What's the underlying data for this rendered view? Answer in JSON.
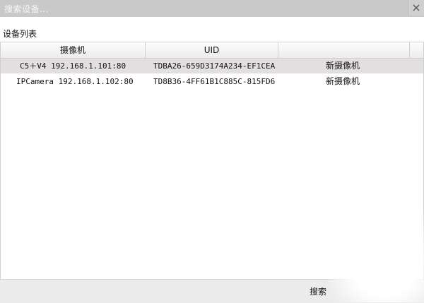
{
  "window": {
    "title": "搜索设备...",
    "close_icon": "close-icon"
  },
  "section": {
    "label": "设备列表"
  },
  "table": {
    "columns": [
      "摄像机",
      "UID",
      ""
    ],
    "rows": [
      {
        "camera": "C5＋V4 192.168.1.101:80",
        "uid": "TDBA26-659D3174A234-EF1CEA",
        "name": "新摄像机",
        "selected": true
      },
      {
        "camera": "IPCamera 192.168.1.102:80",
        "uid": "TD8B36-4FF61B1C885C-815FD6",
        "name": "新摄像机",
        "selected": false
      }
    ]
  },
  "footer": {
    "search_label": "搜索"
  },
  "colors": {
    "titlebar": "#c9c9c9",
    "selected_row": "#e3dfe0",
    "footer": "#ececec"
  }
}
